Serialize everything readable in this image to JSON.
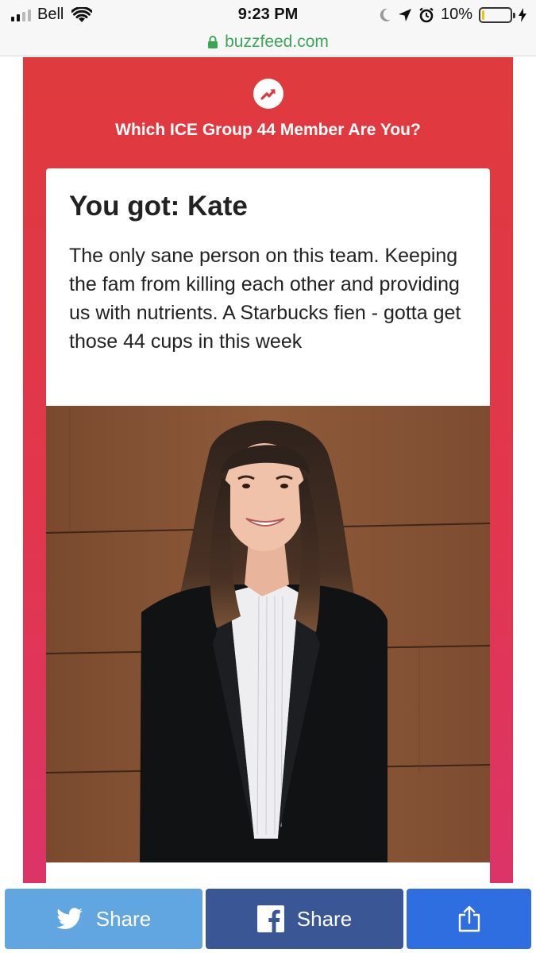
{
  "status_bar": {
    "carrier": "Bell",
    "time": "9:23 PM",
    "battery_percent_label": "10%",
    "battery_level": 0.1,
    "signal_bars_active": 2,
    "signal_bars_total": 4
  },
  "url_bar": {
    "domain": "buzzfeed.com"
  },
  "quiz": {
    "title": "Which ICE Group 44 Member Are You?",
    "result_heading": "You got: Kate",
    "result_description": "The only sane person on this team. Keeping the fam from killing each other and providing us with nutrients. A Starbucks fien - gotta get those 44 cups in this week",
    "trending_icon": "trending-arrow-icon"
  },
  "share_bar": {
    "twitter_label": "Share",
    "facebook_label": "Share",
    "twitter_icon": "twitter-bird-icon",
    "facebook_icon": "facebook-f-icon",
    "native_icon": "share-upload-icon"
  },
  "colors": {
    "quiz_red": "#df3a3d",
    "quiz_pink": "#dc3468",
    "twitter": "#61a6e0",
    "facebook": "#3a5695",
    "native_share": "#2f6ee0",
    "url_green": "#3aa757",
    "battery_yellow": "#f2c400"
  }
}
